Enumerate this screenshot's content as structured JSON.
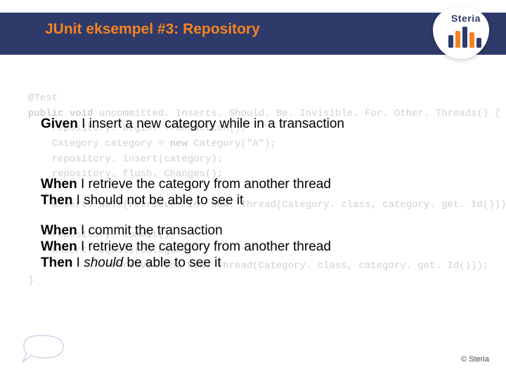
{
  "title": "JUnit eksempel #3: Repository",
  "logoText": "Steria",
  "code": {
    "l1": "@Test",
    "l2a": "public void",
    "l2b": " uncommitted. Inserts. Should. Be. Invisible. For. Other. Threads() {",
    "l3": "    repository. begin. Transaction();",
    "l4a": "    Category category = ",
    "l4b": "new",
    "l4c": " Category(\"A\");",
    "l5": "    repository. insert(category);",
    "l6": "    repository. flush. Changes();",
    "l7": "",
    "l8": "    assert. Null(retrieve. In. New. Thread(Category. class, category. get. Id()));",
    "l9": "",
    "l10": "    repository. commit();",
    "l11": "    assert. Equals(category,",
    "l12": "             retrieve. In. New. Thread(Category. class, category. get. Id()));",
    "l13": "}"
  },
  "overlay": {
    "o1a": "Given",
    "o1b": " I insert a new category while in a transaction",
    "o2a": "When",
    "o2b": " I retrieve the category from another thread",
    "o3a": "Then",
    "o3b": " I should not be able to see it",
    "o4a": "When",
    "o4b": " I commit the transaction",
    "o5a": "When",
    "o5b": " I retrieve the category from another thread",
    "o6a": "Then",
    "o6b": " I ",
    "o6c": "should",
    "o6d": " be able to see it"
  },
  "copyright": "© Steria"
}
